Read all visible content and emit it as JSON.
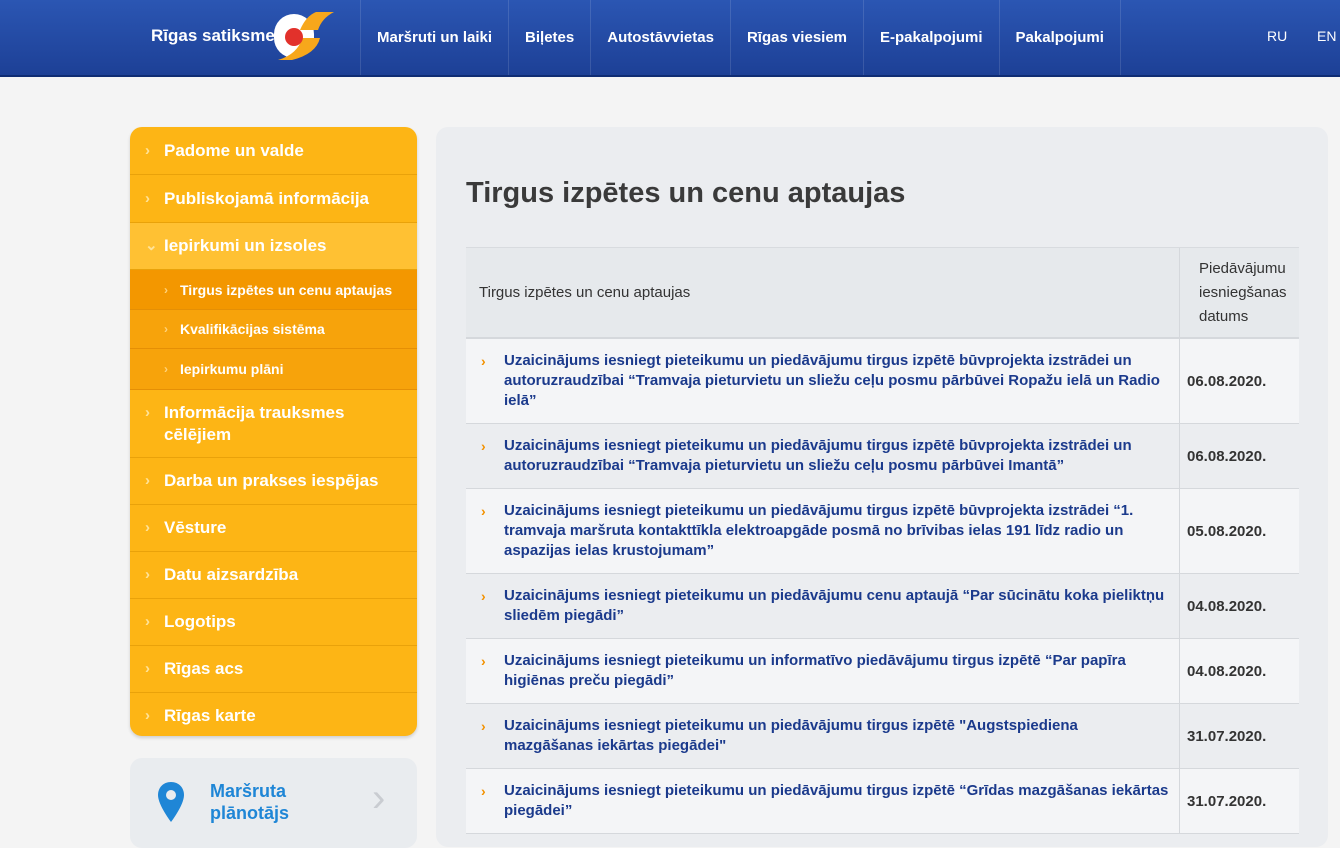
{
  "header": {
    "brand": "Rīgas satiksme",
    "nav": [
      "Maršruti un laiki",
      "Biļetes",
      "Autostāvvietas",
      "Rīgas viesiem",
      "E-pakalpojumi",
      "Pakalpojumi"
    ],
    "languages": [
      "RU",
      "EN"
    ],
    "colors": {
      "bar": "#2b56b3",
      "logo_red": "#e2312b",
      "logo_orange": "#f7a71b"
    }
  },
  "sidebar": {
    "items": [
      {
        "label": "Padome un valde"
      },
      {
        "label": "Publiskojamā informācija"
      },
      {
        "label": "Iepirkumi un izsoles",
        "expanded": true,
        "children": [
          {
            "label": "Tirgus izpētes un cenu aptaujas",
            "current": true
          },
          {
            "label": "Kvalifikācijas sistēma"
          },
          {
            "label": "Iepirkumu plāni"
          }
        ]
      },
      {
        "label": "Informācija trauksmes cēlējiem"
      },
      {
        "label": "Darba un prakses iespējas"
      },
      {
        "label": "Vēsture"
      },
      {
        "label": "Datu aizsardzība"
      },
      {
        "label": "Logotips"
      },
      {
        "label": "Rīgas acs"
      },
      {
        "label": "Rīgas karte"
      }
    ],
    "planner": {
      "line1": "Maršruta",
      "line2": "plānotājs"
    }
  },
  "main": {
    "title": "Tirgus izpētes un cenu aptaujas",
    "table": {
      "col1": "Tirgus izpētes un cenu aptaujas",
      "col2_lines": [
        "Piedāvājumu",
        "iesniegšanas",
        "datums"
      ],
      "rows": [
        {
          "text": "Uzaicinājums iesniegt pieteikumu un piedāvājumu tirgus izpētē būvprojekta izstrādei un autoruzraudzībai “Tramvaja pieturvietu un sliežu ceļu posmu pārbūvei Ropažu ielā un Radio ielā”",
          "date": "06.08.2020."
        },
        {
          "text": "Uzaicinājums iesniegt pieteikumu un piedāvājumu tirgus izpētē būvprojekta izstrādei un autoruzraudzībai “Tramvaja pieturvietu un sliežu ceļu posmu pārbūvei Imantā”",
          "date": "06.08.2020."
        },
        {
          "text": "Uzaicinājums iesniegt pieteikumu un piedāvājumu tirgus izpētē būvprojekta izstrādei “1. tramvaja maršruta kontakttīkla elektroapgāde posmā no brīvibas ielas 191 līdz radio un aspazijas ielas krustojumam”",
          "date": "05.08.2020."
        },
        {
          "text": "Uzaicinājums iesniegt pieteikumu un piedāvājumu cenu aptaujā “Par sūcinātu koka pieliktņu sliedēm piegādi”",
          "date": "04.08.2020."
        },
        {
          "text": "Uzaicinājums iesniegt pieteikumu un informatīvo piedāvājumu tirgus izpētē “Par papīra higiēnas preču piegādi”",
          "date": "04.08.2020."
        },
        {
          "text": "Uzaicinājums iesniegt pieteikumu un piedāvājumu tirgus izpētē \"Augstspiediena mazgāšanas iekārtas piegādei\"",
          "date": "31.07.2020."
        },
        {
          "text": "Uzaicinājums iesniegt pieteikumu un piedāvājumu tirgus izpētē “Grīdas mazgāšanas iekārtas piegādei”",
          "date": "31.07.2020."
        }
      ]
    }
  }
}
